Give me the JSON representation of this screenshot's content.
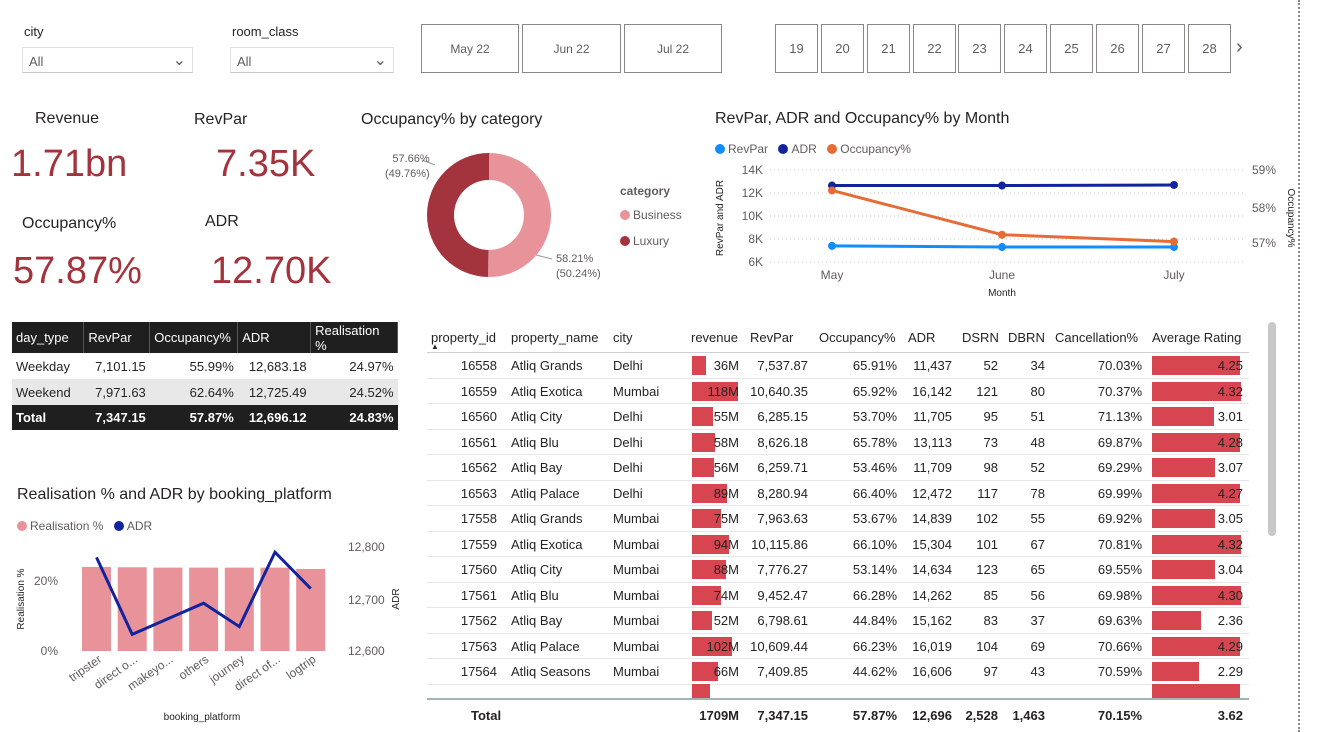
{
  "slicers": {
    "city": {
      "title": "city",
      "value": "All"
    },
    "room_class": {
      "title": "room_class",
      "value": "All"
    },
    "months": [
      "May 22",
      "Jun 22",
      "Jul 22"
    ],
    "weeks": [
      "19",
      "20",
      "21",
      "22",
      "23",
      "24",
      "25",
      "26",
      "27",
      "28"
    ]
  },
  "kpis": {
    "revenue": {
      "label": "Revenue",
      "value": "1.71bn"
    },
    "revpar": {
      "label": "RevPar",
      "value": "7.35K"
    },
    "occupancy": {
      "label": "Occupancy%",
      "value": "57.87%"
    },
    "adr": {
      "label": "ADR",
      "value": "12.70K"
    }
  },
  "donut": {
    "title": "Occupancy% by category",
    "legend_title": "category",
    "colors": {
      "Business": "#e8939a",
      "Luxury": "#a3333d"
    },
    "slices": [
      {
        "name": "Business",
        "value": 58.21,
        "share": 50.24,
        "label": "58.21%",
        "sublabel": "(50.24%)"
      },
      {
        "name": "Luxury",
        "value": 57.66,
        "share": 49.76,
        "label": "57.66%",
        "sublabel": "(49.76%)"
      }
    ]
  },
  "line_chart": {
    "title": "RevPar, ADR and Occupancy% by Month",
    "legend": [
      {
        "name": "RevPar",
        "color": "#118dff"
      },
      {
        "name": "ADR",
        "color": "#12239e"
      },
      {
        "name": "Occupancy%",
        "color": "#e66c37"
      }
    ],
    "y_ticks": [
      "14K",
      "12K",
      "10K",
      "8K",
      "6K"
    ],
    "y2_ticks": [
      "59%",
      "58%",
      "57%"
    ],
    "x_ticks": [
      "May",
      "June",
      "July"
    ],
    "x_title": "Month",
    "y_title": "RevPar and ADR",
    "y2_title": "Occupancy%"
  },
  "chart_data": [
    {
      "type": "pie",
      "title": "Occupancy% by category",
      "categories": [
        "Business",
        "Luxury"
      ],
      "values": [
        58.21,
        57.66
      ],
      "shares": [
        50.24,
        49.76
      ]
    },
    {
      "type": "line",
      "title": "RevPar, ADR and Occupancy% by Month",
      "x": [
        "May",
        "June",
        "July"
      ],
      "ylim": [
        6000,
        14000
      ],
      "y2lim": [
        56.6,
        59.3
      ],
      "series": [
        {
          "name": "RevPar",
          "axis": "left",
          "values": [
            7400,
            7300,
            7300
          ]
        },
        {
          "name": "ADR",
          "axis": "left",
          "values": [
            12650,
            12650,
            12700
          ]
        },
        {
          "name": "Occupancy%",
          "axis": "right",
          "values": [
            58.7,
            57.4,
            57.2
          ]
        }
      ],
      "xlabel": "Month",
      "ylabel": "RevPar and ADR",
      "y2label": "Occupancy%"
    },
    {
      "type": "bar",
      "title": "Realisation % and ADR by booking_platform",
      "categories": [
        "tripster",
        "direct o...",
        "makeyo...",
        "others",
        "journey",
        "direct of...",
        "logtrip"
      ],
      "series": [
        {
          "name": "Realisation %",
          "axis": "left",
          "type": "bar",
          "values": [
            25.0,
            24.9,
            24.8,
            24.8,
            24.8,
            24.8,
            24.4
          ]
        },
        {
          "name": "ADR",
          "axis": "right",
          "type": "line",
          "values": [
            12780,
            12632,
            12662,
            12692,
            12647,
            12790,
            12720
          ]
        }
      ],
      "ylim": [
        0,
        30
      ],
      "y2lim": [
        12590,
        12810
      ],
      "xlabel": "booking_platform",
      "ylabel": "Realisation %",
      "y2label": "ADR"
    }
  ],
  "day_table": {
    "headers": [
      "day_type",
      "RevPar",
      "Occupancy%",
      "ADR",
      "Realisation %"
    ],
    "rows": [
      [
        "Weekday",
        "7,101.15",
        "55.99%",
        "12,683.18",
        "24.97%"
      ],
      [
        "Weekend",
        "7,971.63",
        "62.64%",
        "12,725.49",
        "24.52%"
      ]
    ],
    "total": [
      "Total",
      "7,347.15",
      "57.87%",
      "12,696.12",
      "24.83%"
    ]
  },
  "platform_chart": {
    "title": "Realisation % and ADR by booking_platform",
    "legend": [
      {
        "name": "Realisation %",
        "color": "#e8939a"
      },
      {
        "name": "ADR",
        "color": "#12239e"
      }
    ],
    "y_ticks": [
      "20%",
      "0%"
    ],
    "y2_ticks": [
      "12,800",
      "12,700",
      "12,600"
    ],
    "x_title": "booking_platform",
    "y_title": "Realisation %",
    "y2_title": "ADR"
  },
  "property_table": {
    "headers": [
      "property_id",
      "property_name",
      "city",
      "revenue",
      "RevPar",
      "Occupancy%",
      "ADR",
      "DSRN",
      "DBRN",
      "Cancellation%",
      "Average Rating"
    ],
    "rows": [
      [
        "16558",
        "Atliq Grands",
        "Delhi",
        "36M",
        "7,537.87",
        "65.91%",
        "11,437",
        "52",
        "34",
        "70.03%",
        "4.25"
      ],
      [
        "16559",
        "Atliq Exotica",
        "Mumbai",
        "118M",
        "10,640.35",
        "65.92%",
        "16,142",
        "121",
        "80",
        "70.37%",
        "4.32"
      ],
      [
        "16560",
        "Atliq City",
        "Delhi",
        "55M",
        "6,285.15",
        "53.70%",
        "11,705",
        "95",
        "51",
        "71.13%",
        "3.01"
      ],
      [
        "16561",
        "Atliq Blu",
        "Delhi",
        "58M",
        "8,626.18",
        "65.78%",
        "13,113",
        "73",
        "48",
        "69.87%",
        "4.28"
      ],
      [
        "16562",
        "Atliq Bay",
        "Delhi",
        "56M",
        "6,259.71",
        "53.46%",
        "11,709",
        "98",
        "52",
        "69.29%",
        "3.07"
      ],
      [
        "16563",
        "Atliq Palace",
        "Delhi",
        "89M",
        "8,280.94",
        "66.40%",
        "12,472",
        "117",
        "78",
        "69.99%",
        "4.27"
      ],
      [
        "17558",
        "Atliq Grands",
        "Mumbai",
        "75M",
        "7,963.63",
        "53.67%",
        "14,839",
        "102",
        "55",
        "69.92%",
        "3.05"
      ],
      [
        "17559",
        "Atliq Exotica",
        "Mumbai",
        "94M",
        "10,115.86",
        "66.10%",
        "15,304",
        "101",
        "67",
        "70.81%",
        "4.32"
      ],
      [
        "17560",
        "Atliq City",
        "Mumbai",
        "88M",
        "7,776.27",
        "53.14%",
        "14,634",
        "123",
        "65",
        "69.55%",
        "3.04"
      ],
      [
        "17561",
        "Atliq Blu",
        "Mumbai",
        "74M",
        "9,452.47",
        "66.28%",
        "14,262",
        "85",
        "56",
        "69.98%",
        "4.30"
      ],
      [
        "17562",
        "Atliq Bay",
        "Mumbai",
        "52M",
        "6,798.61",
        "44.84%",
        "15,162",
        "83",
        "37",
        "69.63%",
        "2.36"
      ],
      [
        "17563",
        "Atliq Palace",
        "Mumbai",
        "102M",
        "10,609.44",
        "66.23%",
        "16,019",
        "104",
        "69",
        "70.66%",
        "4.29"
      ],
      [
        "17564",
        "Atliq Seasons",
        "Mumbai",
        "66M",
        "7,409.85",
        "44.62%",
        "16,606",
        "97",
        "43",
        "70.59%",
        "2.29"
      ]
    ],
    "revenue_values": [
      36,
      118,
      55,
      58,
      56,
      89,
      75,
      94,
      88,
      74,
      52,
      102,
      66
    ],
    "rating_values": [
      4.25,
      4.32,
      3.01,
      4.28,
      3.07,
      4.27,
      3.05,
      4.32,
      3.04,
      4.3,
      2.36,
      4.29,
      2.29
    ],
    "total": [
      "Total",
      "",
      "",
      "1709M",
      "7,347.15",
      "57.87%",
      "12,696",
      "2,528",
      "1,463",
      "70.15%",
      "3.62"
    ],
    "bar_color": "#d64550"
  }
}
